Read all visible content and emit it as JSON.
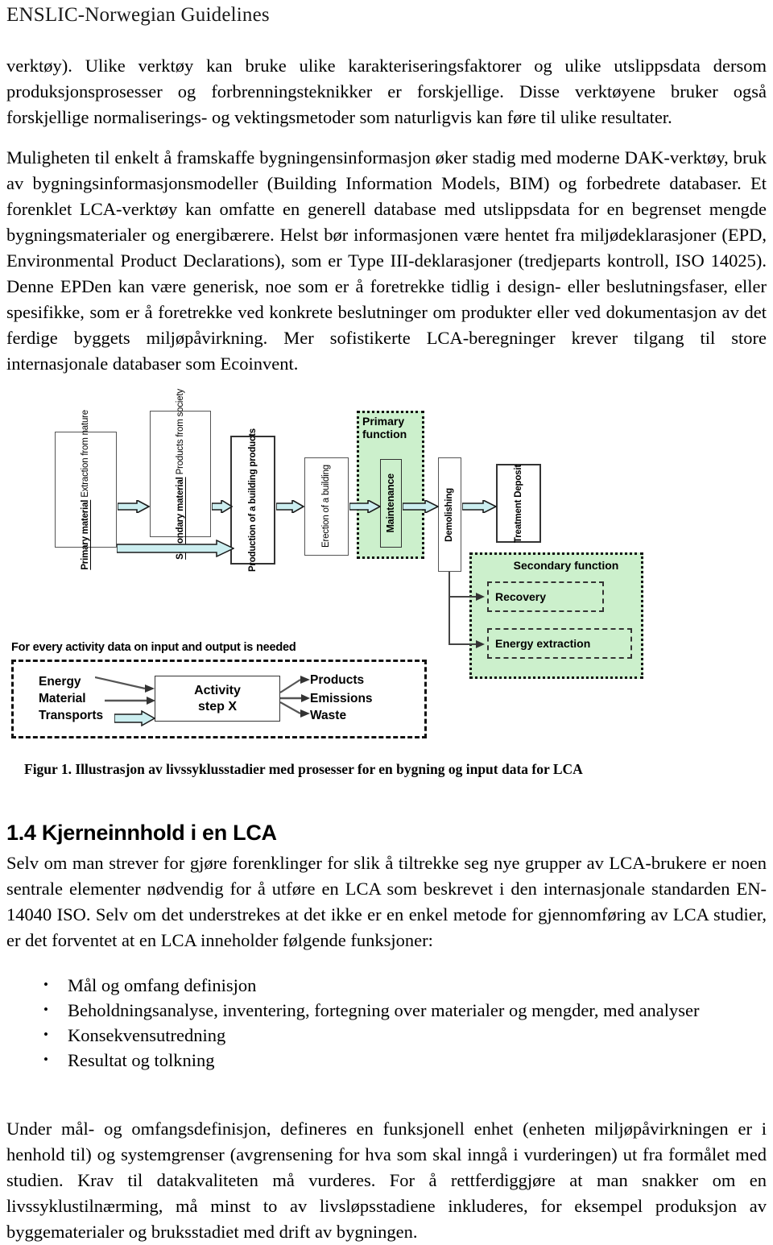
{
  "header": {
    "running_title": "ENSLIC-Norwegian Guidelines"
  },
  "body": {
    "paragraph_1": "verktøy). Ulike verktøy kan bruke ulike karakteriseringsfaktorer og ulike utslippsdata dersom produksjonsprosesser og forbrenningsteknikker er forskjellige. Disse verktøyene bruker også forskjellige normaliserings- og vektingsmetoder som naturligvis kan føre til ulike resultater.",
    "paragraph_2": "Muligheten til enkelt å framskaffe bygningensinformasjon øker stadig med moderne DAK-verktøy, bruk av bygningsinformasjonsmodeller (Building Information Models, BIM) og forbedrete databaser. Et forenklet LCA-verktøy kan omfatte en generell database med utslippsdata for en begrenset mengde bygningsmaterialer og energibærere. Helst bør informasjonen være hentet fra miljødeklarasjoner (EPD, Environmental Product Declarations), som er Type III-deklarasjoner (tredjeparts kontroll, ISO 14025). Denne EPDen kan være generisk, noe som er å foretrekke tidlig i design- eller beslutningsfaser, eller spesifikke, som er å foretrekke ved konkrete beslutninger om produkter eller ved dokumentasjon av det ferdige byggets miljøpåvirkning. Mer sofistikerte LCA-beregninger krever tilgang til store internasjonale databaser som Ecoinvent."
  },
  "figure": {
    "caption": "Figur 1. Illustrasjon av livssyklusstadier med prosesser for en bygning og input data for LCA",
    "colors": {
      "group_fill": "#ccf0cc",
      "arrow_fill": "#cceef0",
      "stroke": "#333333"
    },
    "stages": [
      {
        "line1": "Primary material",
        "line2": "Extraction from nature"
      },
      {
        "line1": "Secondary material",
        "line2": "Products from society"
      },
      {
        "line1": "Production of a",
        "line2": "building products"
      },
      {
        "line1": "Erection of",
        "line2": "a building"
      },
      {
        "line1": "Maintenance",
        "line2": ""
      },
      {
        "line1": "Demolishing",
        "line2": ""
      },
      {
        "line1": "Treatment",
        "line2": "Deposit"
      }
    ],
    "groups": {
      "primary_function": "Primary\nfunction",
      "primary_function_l1": "Primary",
      "primary_function_l2": "function",
      "secondary_function": "Secondary function",
      "secondary_items": [
        "Recovery",
        "Energy extraction"
      ]
    },
    "activity_panel": {
      "caption": "For every activity data on input and output is needed",
      "box_line1": "Activity",
      "box_line2": "step X",
      "inputs": [
        "Energy",
        "Material",
        "Transports"
      ],
      "outputs": [
        "Products",
        "Emissions",
        "Waste"
      ]
    }
  },
  "section": {
    "heading": "1.4 Kjerneinnhold i en LCA",
    "intro": "Selv om man strever for gjøre forenklinger for slik å tiltrekke seg nye grupper av LCA-brukere er noen sentrale elementer nødvendig for å utføre en LCA som beskrevet i den internasjonale standarden EN-14040 ISO. Selv om det understrekes at det ikke er en enkel metode for gjennomføring av LCA studier, er det forventet at en LCA inneholder følgende funksjoner:",
    "bullets": [
      "Mål og omfang definisjon",
      "Beholdningsanalyse, inventering, fortegning over materialer og mengder, med analyser",
      "Konsekvensutredning",
      "Resultat og tolkning"
    ],
    "closing": "Under mål- og omfangsdefinisjon, defineres en funksjonell enhet (enheten miljøpåvirkningen er i henhold til) og systemgrenser (avgrensening for hva som skal inngå i vurderingen) ut fra formålet med studien. Krav til datakvaliteten må vurderes. For å rettferdiggjøre at man snakker om en livssyklustilnærming, må minst to av livsløpsstadiene inkluderes, for eksempel produksjon av byggematerialer og bruksstadiet med drift av bygningen."
  }
}
